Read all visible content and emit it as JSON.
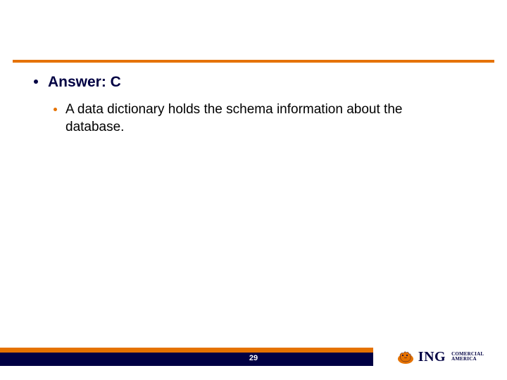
{
  "content": {
    "answer_label": "Answer: C",
    "detail": "A data dictionary holds the schema information about the database."
  },
  "footer": {
    "page_number": "29",
    "brand_name": "ING",
    "brand_sub_line1": "COMERCIAL",
    "brand_sub_line2": "AMERICA"
  },
  "colors": {
    "accent_orange": "#e57200",
    "brand_navy": "#000043"
  }
}
